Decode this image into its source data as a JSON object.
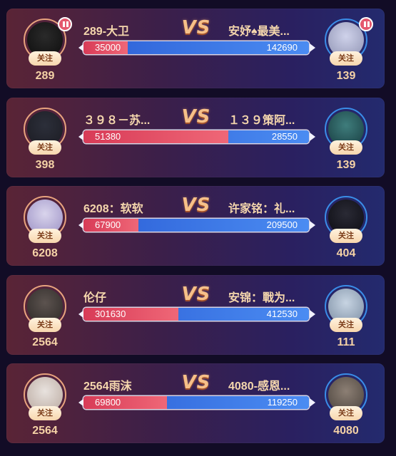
{
  "follow_label": "关注",
  "vs_label": "VS",
  "colors": {
    "red_team": "#e34b63",
    "blue_team": "#3a75e6",
    "accent": "#f5d2a6"
  },
  "battles": [
    {
      "left": {
        "name": "289-大卫",
        "score": "289",
        "paused": true
      },
      "right": {
        "name": "安妤♠最美...",
        "score": "139",
        "paused": true
      },
      "left_value": "35000",
      "right_value": "142690"
    },
    {
      "left": {
        "name": "３９８－苏...",
        "score": "398",
        "paused": false
      },
      "right": {
        "name": "１３９策阿...",
        "score": "139",
        "paused": false
      },
      "left_value": "51380",
      "right_value": "28550"
    },
    {
      "left": {
        "name": "6208：软软",
        "score": "6208",
        "paused": false
      },
      "right": {
        "name": "许家铭：礼...",
        "score": "404",
        "paused": false
      },
      "left_value": "67900",
      "right_value": "209500"
    },
    {
      "left": {
        "name": "伦仔",
        "score": "2564",
        "paused": false
      },
      "right": {
        "name": "安锦：戰为...",
        "score": "111",
        "paused": false
      },
      "left_value": "301630",
      "right_value": "412530"
    },
    {
      "left": {
        "name": "2564雨沫",
        "score": "2564",
        "paused": false
      },
      "right": {
        "name": "4080-感恩...",
        "score": "4080",
        "paused": false
      },
      "left_value": "69800",
      "right_value": "119250"
    }
  ]
}
